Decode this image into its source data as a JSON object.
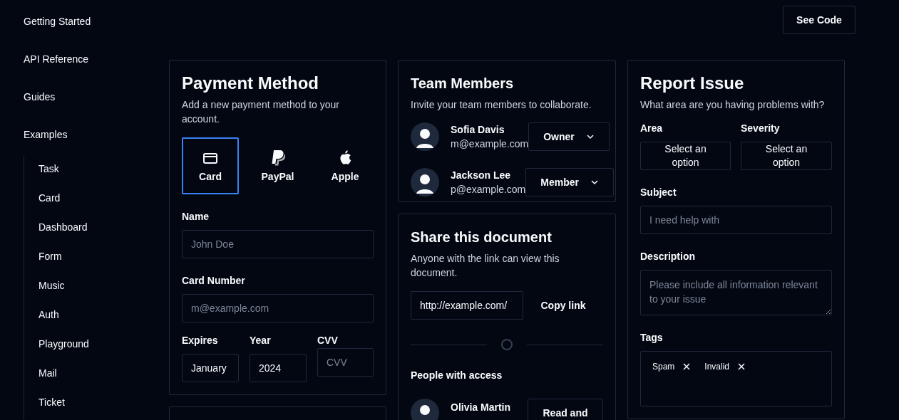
{
  "sidebar": {
    "items": [
      {
        "label": "Getting Started"
      },
      {
        "label": "API Reference"
      },
      {
        "label": "Guides"
      },
      {
        "label": "Examples",
        "children": [
          {
            "label": "Task"
          },
          {
            "label": "Card"
          },
          {
            "label": "Dashboard"
          },
          {
            "label": "Form"
          },
          {
            "label": "Music"
          },
          {
            "label": "Auth"
          },
          {
            "label": "Playground"
          },
          {
            "label": "Mail"
          },
          {
            "label": "Ticket"
          }
        ]
      }
    ]
  },
  "header": {
    "button": "See Code"
  },
  "payment": {
    "title": "Payment Method",
    "description": "Add a new payment method to your account.",
    "methods": [
      {
        "kind": "card",
        "label": "Card",
        "selected": true
      },
      {
        "kind": "paypal",
        "label": "PayPal",
        "selected": false
      },
      {
        "kind": "apple",
        "label": "Apple",
        "selected": false
      }
    ],
    "name": {
      "label": "Name",
      "placeholder": "John Doe"
    },
    "card_number": {
      "label": "Card Number",
      "placeholder": "m@example.com"
    },
    "expires": {
      "label": "Expires",
      "value": "January"
    },
    "year": {
      "label": "Year",
      "value": "2024"
    },
    "cvv": {
      "label": "CVV",
      "placeholder": "CVV"
    }
  },
  "team": {
    "title": "Team Members",
    "description": "Invite your team members to collaborate.",
    "members": [
      {
        "name": "Sofia Davis",
        "email": "m@example.com",
        "role": "Owner"
      },
      {
        "name": "Jackson Lee",
        "email": "p@example.com",
        "role": "Member"
      }
    ]
  },
  "share": {
    "title": "Share this document",
    "description": "Anyone with the link can view this document.",
    "link": "http://example.com/",
    "button": "Copy link",
    "people_title": "People with access",
    "people": [
      {
        "name": "Olivia Martin",
        "access": "Read and"
      }
    ]
  },
  "report": {
    "title": "Report Issue",
    "description": "What area are you having problems with?",
    "area": {
      "label": "Area",
      "value": "Select an option"
    },
    "severity": {
      "label": "Severity",
      "value": "Select an option"
    },
    "subject": {
      "label": "Subject",
      "placeholder": "I need help with"
    },
    "details": {
      "label": "Description",
      "placeholder": "Please include all information relevant to your issue"
    },
    "tags": {
      "label": "Tags",
      "items": [
        "Spam",
        "Invalid"
      ]
    }
  }
}
